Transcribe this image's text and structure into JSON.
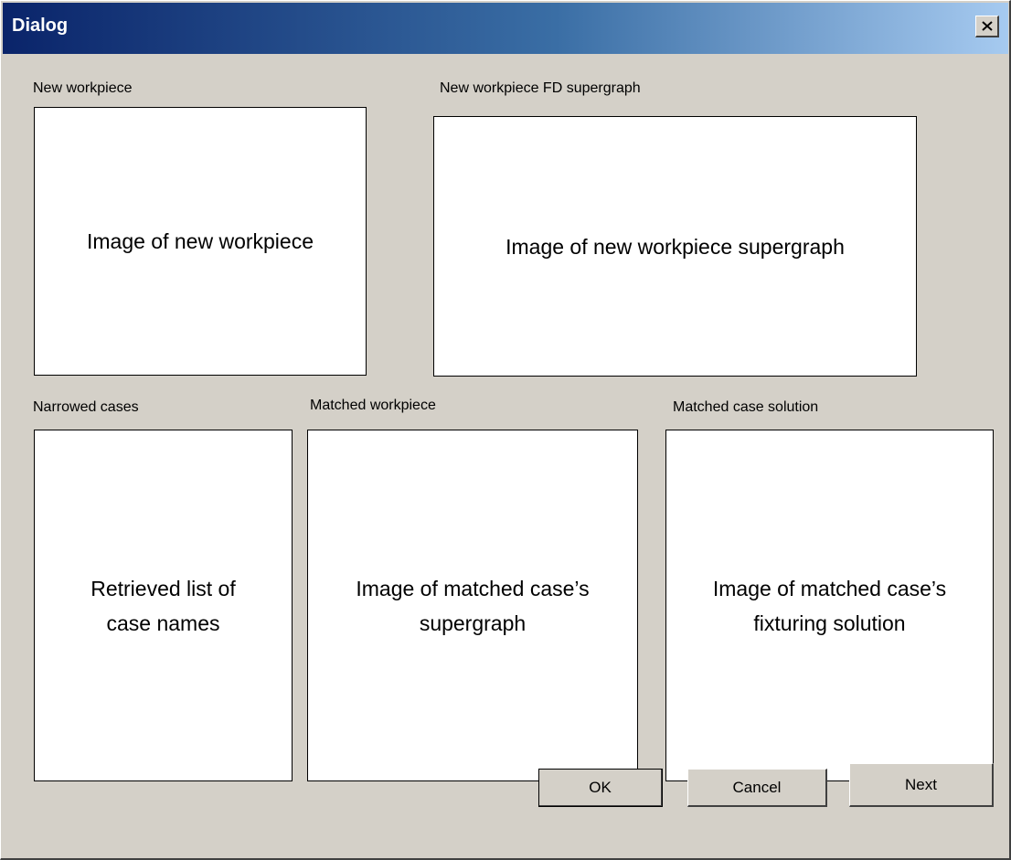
{
  "window": {
    "title": "Dialog"
  },
  "sections": {
    "new_workpiece": {
      "label": "New workpiece",
      "content_line1": "Image of new workpiece"
    },
    "new_workpiece_fd": {
      "label": "New workpiece FD supergraph",
      "content_line1": "Image of new workpiece supergraph"
    },
    "narrowed_cases": {
      "label": "Narrowed cases",
      "content_line1": "Retrieved list of",
      "content_line2": "case names"
    },
    "matched_workpiece": {
      "label": "Matched workpiece",
      "content_line1": "Image of matched case’s",
      "content_line2": "supergraph"
    },
    "matched_solution": {
      "label": "Matched case solution",
      "content_line1": "Image of matched case’s",
      "content_line2": "fixturing solution"
    }
  },
  "buttons": {
    "ok": "OK",
    "cancel": "Cancel",
    "next": "Next"
  },
  "icons": {
    "close": "close-icon"
  },
  "colors": {
    "title_start": "#0a246a",
    "title_end": "#a6caf0",
    "face": "#d4d0c8"
  }
}
